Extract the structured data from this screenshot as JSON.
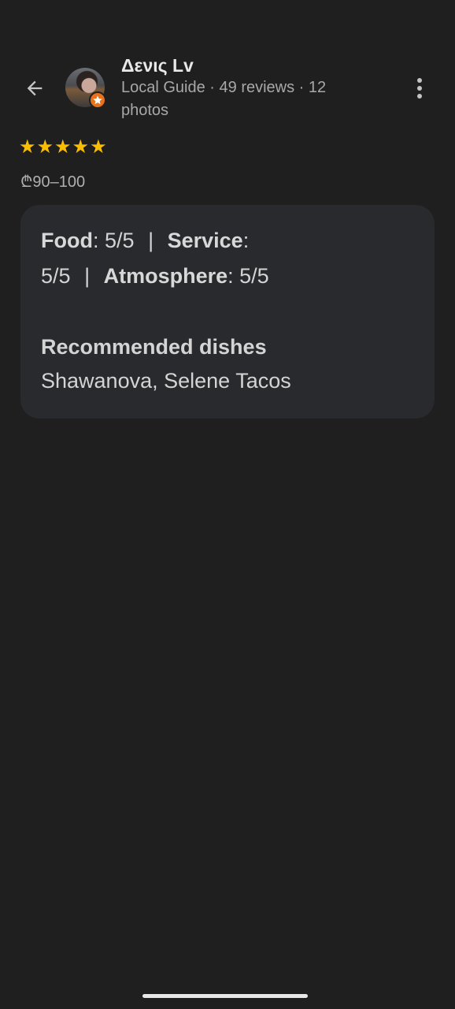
{
  "header": {
    "user_name": "Δενις Lv",
    "user_meta": "Local Guide · 49 reviews · 12 photos"
  },
  "icons": {
    "back": "arrow-left-icon",
    "more": "more-vert-icon",
    "badge": "local-guide-star-icon"
  },
  "review": {
    "rating": 5,
    "max_rating": 5,
    "star_color": "#fbbc04",
    "price_range": "₾90–100"
  },
  "card": {
    "food_label": "Food",
    "food_value": "5/5",
    "service_label": "Service",
    "service_value": "5/5",
    "atmosphere_label": "Atmosphere",
    "atmosphere_value": "5/5",
    "separator": "|",
    "recommended_title": "Recommended dishes",
    "recommended_dishes": "Shawanova, Selene Tacos"
  },
  "colors": {
    "background": "#1f1f1f",
    "card_background": "#282a2d",
    "badge": "#e8711c"
  }
}
